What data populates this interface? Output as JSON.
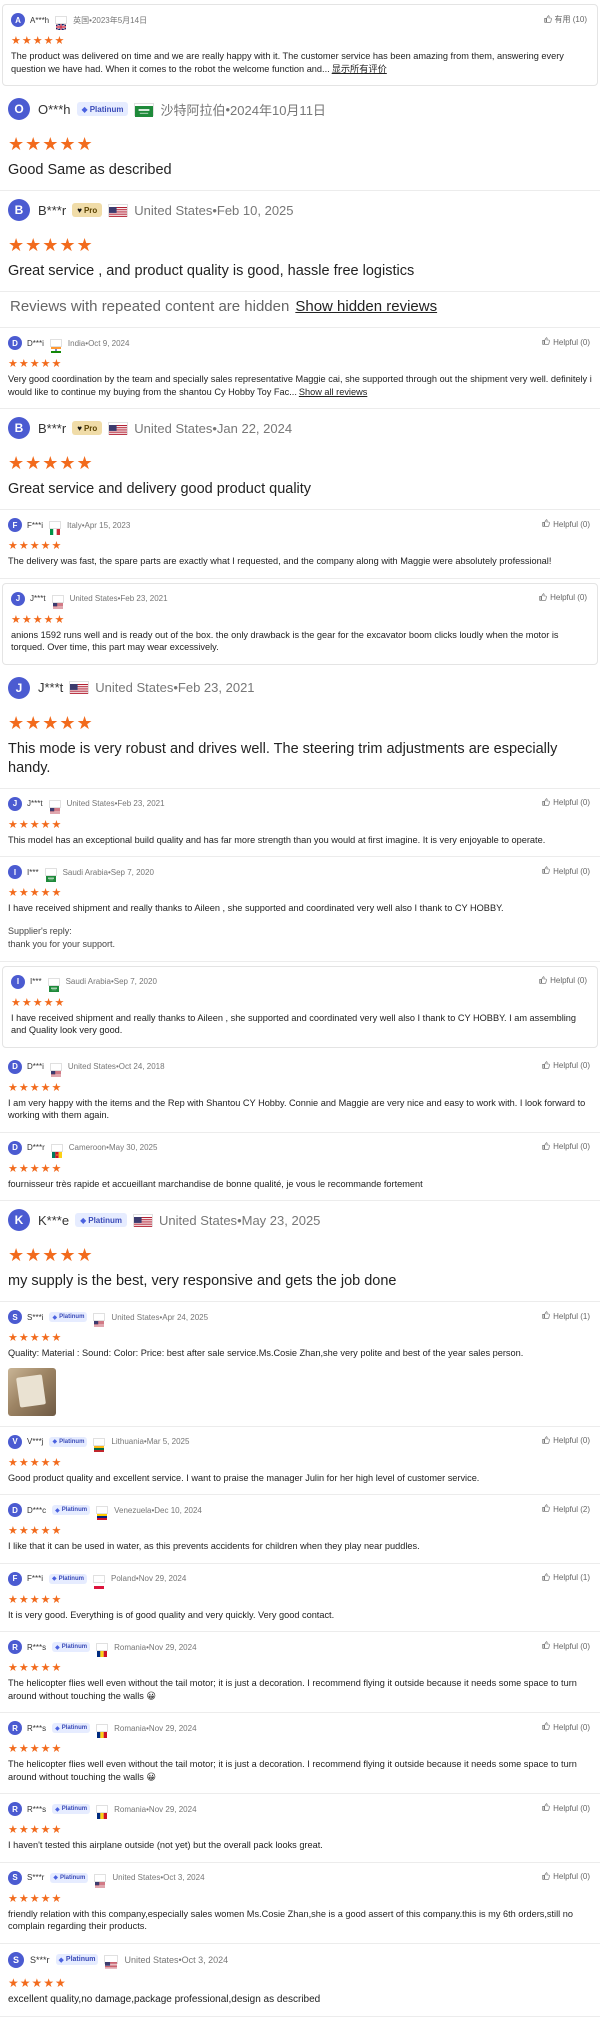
{
  "accent_color": "#f26b1d",
  "avatar_color": "#4b5bd1",
  "stars_glyph": "★★★★★",
  "hidden_notice": {
    "text": "Reviews with repeated content are hidden",
    "link": "Show hidden reviews"
  },
  "reviews": [
    {
      "size": "sm",
      "card": true,
      "initial": "A",
      "name": "A***h",
      "flag": "gb",
      "country": "英国",
      "date": "2023年5月14日",
      "helpful": "有用 (10)",
      "text": "The product was delivered on time and we are really happy with it. The customer service has been amazing from them, answering every question we have had. When it comes to the robot the welcome function and...",
      "more": "显示所有评价"
    },
    {
      "size": "lg",
      "initial": "O",
      "name": "O***h",
      "badge": "Platinum",
      "flag": "sa",
      "country": "沙特阿拉伯",
      "date": "2024年10月11日",
      "text": "Good Same as described"
    },
    {
      "size": "lg",
      "initial": "B",
      "name": "B***r",
      "badge": "Pro",
      "flag": "us",
      "country": "United States",
      "date": "Feb 10, 2025",
      "text": "Great service , and product quality is good, hassle free logistics"
    },
    {
      "size": "sm",
      "initial": "D",
      "name": "D***i",
      "flag": "in",
      "country": "India",
      "date": "Oct 9, 2024",
      "helpful": "Helpful (0)",
      "text": "Very good coordination by the team and specially sales representative Maggie cai, she supported through out the shipment very well. definitely i would like to continue my buying from the shantou Cy Hobby Toy Fac...",
      "more": "Show all reviews"
    },
    {
      "size": "lg",
      "initial": "B",
      "name": "B***r",
      "badge": "Pro",
      "flag": "us",
      "country": "United States",
      "date": "Jan 22, 2024",
      "text": "Great service and delivery good product quality"
    },
    {
      "size": "sm",
      "initial": "F",
      "name": "F***i",
      "flag": "it",
      "country": "Italy",
      "date": "Apr 15, 2023",
      "helpful": "Helpful (0)",
      "text": "The delivery was fast, the spare parts are exactly what I requested, and the company along with Maggie were absolutely professional!"
    },
    {
      "size": "sm",
      "card": true,
      "initial": "J",
      "name": "J***t",
      "flag": "us",
      "country": "United States",
      "date": "Feb 23, 2021",
      "helpful": "Helpful (0)",
      "text": "anions 1592 runs well and is ready out of the box. the only drawback is the gear for the excavator boom clicks loudly when the motor is torqued. Over time, this part may wear excessively."
    },
    {
      "size": "lg",
      "initial": "J",
      "name": "J***t",
      "flag": "us",
      "country": "United States",
      "date": "Feb 23, 2021",
      "text": "This mode is very robust and drives well. The steering trim adjustments are especially handy."
    },
    {
      "size": "sm",
      "initial": "J",
      "name": "J***t",
      "flag": "us",
      "country": "United States",
      "date": "Feb 23, 2021",
      "helpful": "Helpful (0)",
      "text": "This model has an exceptional build quality and has far more strength than you would at first imagine. It is very enjoyable to operate."
    },
    {
      "size": "sm",
      "initial": "I",
      "name": "I***",
      "flag": "sa",
      "country": "Saudi Arabia",
      "date": "Sep 7, 2020",
      "helpful": "Helpful (0)",
      "text": "I have received shipment and really thanks to Aileen , she supported and coordinated very well also I thank to CY HOBBY.",
      "reply_label": "Supplier's reply:",
      "reply_text": "thank you for your support."
    },
    {
      "size": "sm",
      "card": true,
      "initial": "I",
      "name": "I***",
      "flag": "sa",
      "country": "Saudi Arabia",
      "date": "Sep 7, 2020",
      "helpful": "Helpful (0)",
      "text": "I have received shipment and really thanks to Aileen , she supported and coordinated very well also I thank to CY HOBBY. I am assembling and Quality look very good."
    },
    {
      "size": "sm",
      "initial": "D",
      "name": "D***i",
      "flag": "us",
      "country": "United States",
      "date": "Oct 24, 2018",
      "helpful": "Helpful (0)",
      "text": "I am very happy with the items and the Rep with Shantou CY Hobby. Connie and Maggie are very nice and easy to work with. I look forward to working with them again."
    },
    {
      "size": "sm",
      "initial": "D",
      "name": "D***r",
      "flag": "cm",
      "country": "Cameroon",
      "date": "May 30, 2025",
      "helpful": "Helpful (0)",
      "text": "fournisseur très rapide et accueillant marchandise de bonne qualité, je vous le recommande fortement"
    },
    {
      "size": "lg",
      "initial": "K",
      "name": "K***e",
      "badge": "Platinum",
      "flag": "us",
      "country": "United States",
      "date": "May 23, 2025",
      "text": "my supply is the best, very responsive and gets the job done"
    },
    {
      "size": "sm",
      "initial": "S",
      "name": "S***i",
      "badge": "Platinum",
      "flag": "us",
      "country": "United States",
      "date": "Apr 24, 2025",
      "helpful": "Helpful (1)",
      "text": "Quality:  Material :  Sound:  Color:  Price: best after sale service.Ms.Cosie Zhan,she very polite and best of the year sales person.",
      "photo": true
    },
    {
      "size": "sm",
      "initial": "V",
      "name": "V***j",
      "badge": "Platinum",
      "flag": "lt",
      "country": "Lithuania",
      "date": "Mar 5, 2025",
      "helpful": "Helpful (0)",
      "text": "Good product quality and excellent service. I want to praise the manager Julin for her high level of customer service."
    },
    {
      "size": "sm",
      "initial": "D",
      "name": "D***c",
      "badge": "Platinum",
      "flag": "ve",
      "country": "Venezuela",
      "date": "Dec 10, 2024",
      "helpful": "Helpful (2)",
      "text": "I like that it can be used in water, as this prevents accidents for children when they play near puddles."
    },
    {
      "size": "sm",
      "initial": "F",
      "name": "F***i",
      "badge": "Platinum",
      "flag": "pl",
      "country": "Poland",
      "date": "Nov 29, 2024",
      "helpful": "Helpful (1)",
      "text": "It is very good. Everything is of good quality and very quickly. Very good contact."
    },
    {
      "size": "sm",
      "initial": "R",
      "name": "R***s",
      "badge": "Platinum",
      "flag": "ro",
      "country": "Romania",
      "date": "Nov 29, 2024",
      "helpful": "Helpful (0)",
      "text": "The helicopter flies well even without the tail motor; it is just a decoration. I recommend flying it outside because it needs some space to turn around without touching the walls 😀"
    },
    {
      "size": "sm",
      "initial": "R",
      "name": "R***s",
      "badge": "Platinum",
      "flag": "ro",
      "country": "Romania",
      "date": "Nov 29, 2024",
      "helpful": "Helpful (0)",
      "text": "The helicopter flies well even without the tail motor; it is just a decoration. I recommend flying it outside because it needs some space to turn around without touching the walls 😀"
    },
    {
      "size": "sm",
      "initial": "R",
      "name": "R***s",
      "badge": "Platinum",
      "flag": "ro",
      "country": "Romania",
      "date": "Nov 29, 2024",
      "helpful": "Helpful (0)",
      "text": "I haven't tested this airplane outside (not yet) but the overall pack looks great."
    },
    {
      "size": "sm",
      "initial": "S",
      "name": "S***r",
      "badge": "Platinum",
      "flag": "us",
      "country": "United States",
      "date": "Oct 3, 2024",
      "helpful": "Helpful (0)",
      "text": "friendly relation with this company,especially sales women Ms.Cosie Zhan,she is a good assert of this company.this is my 6th orders,still no complain regarding their products."
    },
    {
      "size": "md",
      "initial": "S",
      "name": "S***r",
      "badge": "Platinum",
      "flag": "us",
      "country": "United States",
      "date": "Oct 3, 2024",
      "text": "excellent quality,no damage,package professional,design as described"
    }
  ]
}
